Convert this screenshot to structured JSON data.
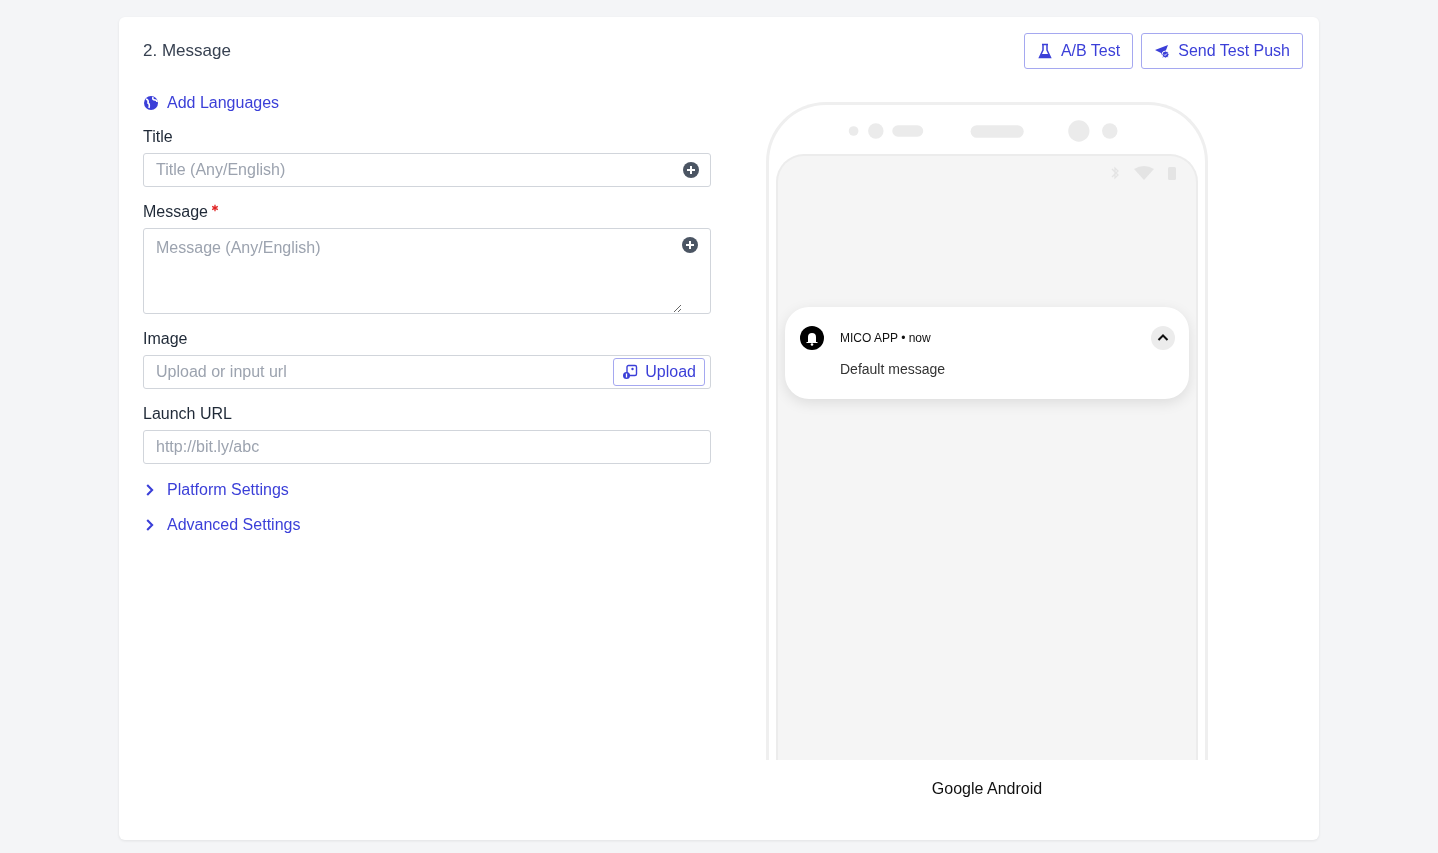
{
  "section": {
    "title": "2. Message"
  },
  "header_buttons": [
    {
      "kind": "flask",
      "label": "A/B Test"
    },
    {
      "kind": "send",
      "label": "Send Test Push"
    }
  ],
  "add_languages": {
    "label": "Add Languages"
  },
  "fields": [
    {
      "kind": "text",
      "label": "Title",
      "required": false,
      "placeholder": "Title (Any/English)",
      "addable": true
    },
    {
      "kind": "textarea",
      "label": "Message",
      "required": true,
      "placeholder": "Message (Any/English)",
      "addable": true
    },
    {
      "kind": "upload",
      "label": "Image",
      "required": false,
      "placeholder": "Upload or input url",
      "button": "Upload",
      "addable": false
    },
    {
      "kind": "text",
      "label": "Launch URL",
      "required": false,
      "placeholder": "http://bit.ly/abc",
      "addable": false
    }
  ],
  "collapsibles": [
    {
      "label": "Platform Settings",
      "expanded": false
    },
    {
      "label": "Advanced Settings",
      "expanded": false
    }
  ],
  "preview": {
    "app": "MICO APP • now",
    "message": "Default message",
    "device": "Google Android"
  }
}
